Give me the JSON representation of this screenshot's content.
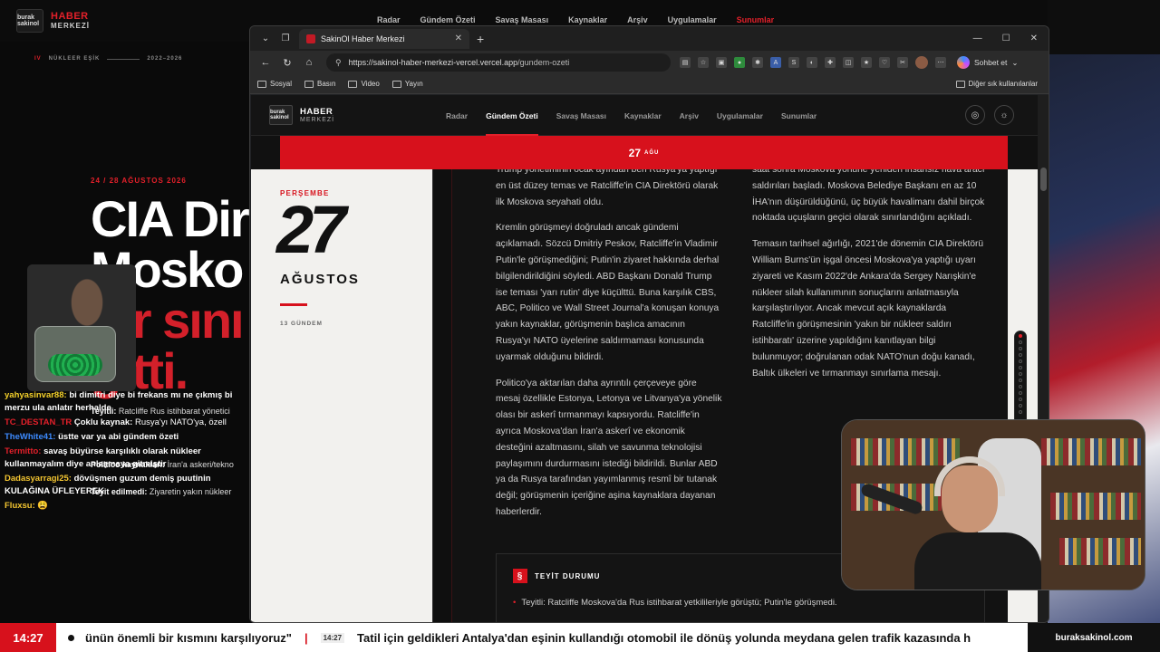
{
  "background": {
    "logo": {
      "badge": "burak sakinol",
      "title": "HABER",
      "subtitle": "MERKEZİ"
    },
    "nav": [
      "Radar",
      "Gündem Özeti",
      "Savaş Masası",
      "Kaynaklar",
      "Arşiv",
      "Uygulamalar",
      "Sunumlar"
    ],
    "eyebrow": {
      "num": "IV",
      "label": "NÜKLEER EŞİK",
      "years": "2022–2026"
    },
    "date": "24 / 28 AĞUSTOS 2026",
    "headline_l1": "CIA Dir",
    "headline_l2": "Mosko",
    "headline_l3": "bir sını",
    "headline_l4": "gitti."
  },
  "chat": [
    {
      "user": "yahyasinvar88:",
      "text": "bi dimitri diye bi frekans mı ne çıkmış bi merzu ula anlatır herhalde"
    },
    {
      "user": "TC_DESTAN_TR",
      "text": ""
    },
    {
      "user": "TheWhite41:",
      "text": "üstte var ya abi gündem özeti"
    },
    {
      "user": "Termitto:",
      "text": "savaş büyürse karşılıklı olarak nükleer kullanmayalım diye anlaşmaya gitmiştir"
    },
    {
      "user": "Dadasyarragi25:",
      "text": "dövüşmen guzum demiş puutinin KULAĞINA ÜFLEYEREK"
    },
    {
      "user": "Fluxsu:",
      "text": "😩"
    }
  ],
  "behind_text": [
    {
      "label": "Teyitli:",
      "text": "Ratcliffe Rus istihbarat yönetici"
    },
    {
      "label": "Çoklu kaynak:",
      "text": "Rusya'yı NATO'ya, özell"
    },
    {
      "label": "Politico kaynakları:",
      "text": "İran'a askeri/tekno"
    },
    {
      "label": "Teyit edilmedi:",
      "text": "Ziyaretin yakın nükleer"
    }
  ],
  "browser": {
    "tab_title": "SakinOl Haber Merkezi",
    "url_host": "https://sakinol-haber-merkezi-vercel.vercel.app",
    "url_path": "/gundem-ozeti",
    "chat_button": "Sohbet et",
    "bookmarks": [
      "Sosyal",
      "Basın",
      "Video",
      "Yayın"
    ],
    "bookmarks_right": "Diğer sık kullanılanlar"
  },
  "site": {
    "logo_title": "HABER",
    "logo_sub": "MERKEZİ",
    "nav": [
      "Radar",
      "Gündem Özeti",
      "Savaş Masası",
      "Kaynaklar",
      "Arşiv",
      "Uygulamalar",
      "Sunumlar"
    ],
    "active_nav": "Gündem Özeti",
    "date_bar": {
      "day": "27",
      "month": "AĞU"
    },
    "left": {
      "weekday": "PERŞEMBE",
      "day": "27",
      "month": "AĞUSTOS",
      "count": "13 GÜNDEM"
    },
    "col1": [
      "Trump yönetiminin ocak ayından beri Rusya'ya yaptığı en üst düzey temas ve Ratcliffe'in CIA Direktörü olarak ilk Moskova seyahati oldu.",
      "Kremlin görüşmeyi doğruladı ancak gündemi açıklamadı. Sözcü Dmitriy Peskov, Ratcliffe'in Vladimir Putin'le görüşmediğini; Putin'in ziyaret hakkında derhal bilgilendirildiğini söyledi. ABD Başkanı Donald Trump ise teması 'yarı rutin' diye küçülttü. Buna karşılık CBS, ABC, Politico ve Wall Street Journal'a konuşan konuya yakın kaynaklar, görüşmenin başlıca amacının Rusya'yı NATO üyelerine saldırmaması konusunda uyarmak olduğunu bildirdi.",
      "Politico'ya aktarılan daha ayrıntılı çerçeveye göre mesaj özellikle Estonya, Letonya ve Litvanya'ya yönelik olası bir askerî tırmanmayı kapsıyordu. Ratcliffe'in ayrıca Moskova'dan İran'a askerî ve ekonomik desteğini azaltmasını, silah ve savunma teknolojisi paylaşımını durdurmasını istediği bildirildi. Bunlar ABD ya da Rusya tarafından yayımlanmış resmî bir tutanak değil; görüşmenin içeriğine aşina kaynaklara dayanan haberlerdir."
    ],
    "col2": [
      "saat sonra Moskova yönüne yeniden insansız hava aracı saldırıları başladı. Moskova Belediye Başkanı en az 10 İHA'nın düşürüldüğünü, üç büyük havalimanı dahil birçok noktada uçuşların geçici olarak sınırlandığını açıkladı.",
      "Temasın tarihsel ağırlığı, 2021'de dönemin CIA Direktörü William Burns'ün işgal öncesi Moskova'ya yaptığı uyarı ziyareti ve Kasım 2022'de Ankara'da Sergey Narışkin'e nükleer silah kullanımının sonuçlarını anlatmasıyla karşılaştırılıyor. Ancak mevcut açık kaynaklarda Ratcliffe'in görüşmesinin 'yakın bir nükleer saldırı istihbaratı' üzerine yapıldığını kanıtlayan bilgi bulunmuyor; doğrulanan odak NATO'nun doğu kanadı, Baltık ülkeleri ve tırmanmayı sınırlama mesajı."
    ],
    "teyit": {
      "title": "TEYİT DURUMU",
      "item": "Teyitli: Ratcliffe Moskova'da Rus istihbarat yetkilileriyle görüştü; Putin'le görüşmedi."
    }
  },
  "ticker": {
    "time": "14:27",
    "text1": "ünün önemli bir kısmını karşılıyoruz\"",
    "stamp": "14:27",
    "text2": "Tatil için geldikleri Antalya'dan eşinin kullandığı otomobil ile dönüş yolunda meydana gelen trafik kazasında h",
    "brand": "buraksakinol.com"
  }
}
